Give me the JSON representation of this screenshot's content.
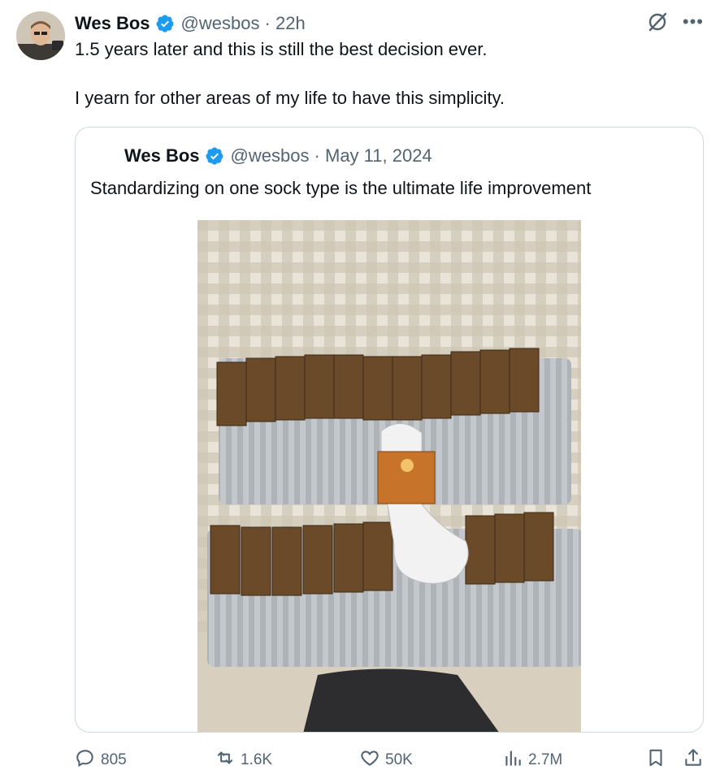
{
  "tweet": {
    "author_name": "Wes Bos",
    "handle_time": "@wesbos · 22h",
    "text_line1": "1.5 years later and this is still the best decision ever.",
    "text_line2": "I yearn for other areas of my life to have this simplicity."
  },
  "quoted": {
    "author_name": "Wes Bos",
    "handle_date": "@wesbos · May 11, 2024",
    "text": "Standardizing on one sock type is the ultimate life improvement"
  },
  "actions": {
    "replies": "805",
    "reposts": "1.6K",
    "likes": "50K",
    "views": "2.7M"
  },
  "icons": [
    "verified-icon",
    "grok-icon",
    "more-icon",
    "reply-icon",
    "repost-icon",
    "like-icon",
    "views-icon",
    "bookmark-icon",
    "share-icon"
  ],
  "colors": {
    "verified": "#1d9bf0",
    "secondary_text": "#536471",
    "border": "#cfd9de"
  }
}
